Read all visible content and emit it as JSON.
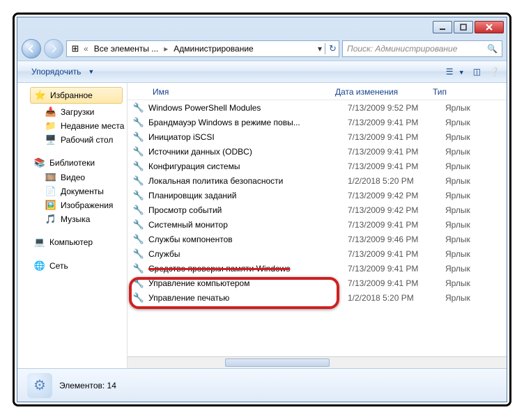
{
  "address": {
    "root": "Все элементы ...",
    "current": "Администрирование"
  },
  "search": {
    "placeholder": "Поиск: Администрирование"
  },
  "toolbar": {
    "organize": "Упорядочить"
  },
  "sidebar": {
    "favorites": "Избранное",
    "fav_items": [
      "Загрузки",
      "Недавние места",
      "Рабочий стол"
    ],
    "libraries": "Библиотеки",
    "lib_items": [
      "Видео",
      "Документы",
      "Изображения",
      "Музыка"
    ],
    "computer": "Компьютер",
    "network": "Сеть"
  },
  "columns": {
    "name": "Имя",
    "date": "Дата изменения",
    "type": "Тип"
  },
  "files": [
    {
      "name": "Windows PowerShell Modules",
      "date": "7/13/2009 9:52 PM",
      "type": "Ярлык"
    },
    {
      "name": "Брандмауэр Windows в режиме повы...",
      "date": "7/13/2009 9:41 PM",
      "type": "Ярлык"
    },
    {
      "name": "Инициатор iSCSI",
      "date": "7/13/2009 9:41 PM",
      "type": "Ярлык"
    },
    {
      "name": "Источники данных (ODBC)",
      "date": "7/13/2009 9:41 PM",
      "type": "Ярлык"
    },
    {
      "name": "Конфигурация системы",
      "date": "7/13/2009 9:41 PM",
      "type": "Ярлык"
    },
    {
      "name": "Локальная политика безопасности",
      "date": "1/2/2018 5:20 PM",
      "type": "Ярлык"
    },
    {
      "name": "Планировщик заданий",
      "date": "7/13/2009 9:42 PM",
      "type": "Ярлык"
    },
    {
      "name": "Просмотр событий",
      "date": "7/13/2009 9:42 PM",
      "type": "Ярлык"
    },
    {
      "name": "Системный монитор",
      "date": "7/13/2009 9:41 PM",
      "type": "Ярлык"
    },
    {
      "name": "Службы компонентов",
      "date": "7/13/2009 9:46 PM",
      "type": "Ярлык"
    },
    {
      "name": "Службы",
      "date": "7/13/2009 9:41 PM",
      "type": "Ярлык"
    },
    {
      "name": "Средство проверки памяти Windows",
      "date": "7/13/2009 9:41 PM",
      "type": "Ярлык"
    },
    {
      "name": "Управление компьютером",
      "date": "7/13/2009 9:41 PM",
      "type": "Ярлык"
    },
    {
      "name": "Управление печатью",
      "date": "1/2/2018 5:20 PM",
      "type": "Ярлык"
    }
  ],
  "status": {
    "count": "Элементов: 14"
  },
  "highlight_index": 12
}
